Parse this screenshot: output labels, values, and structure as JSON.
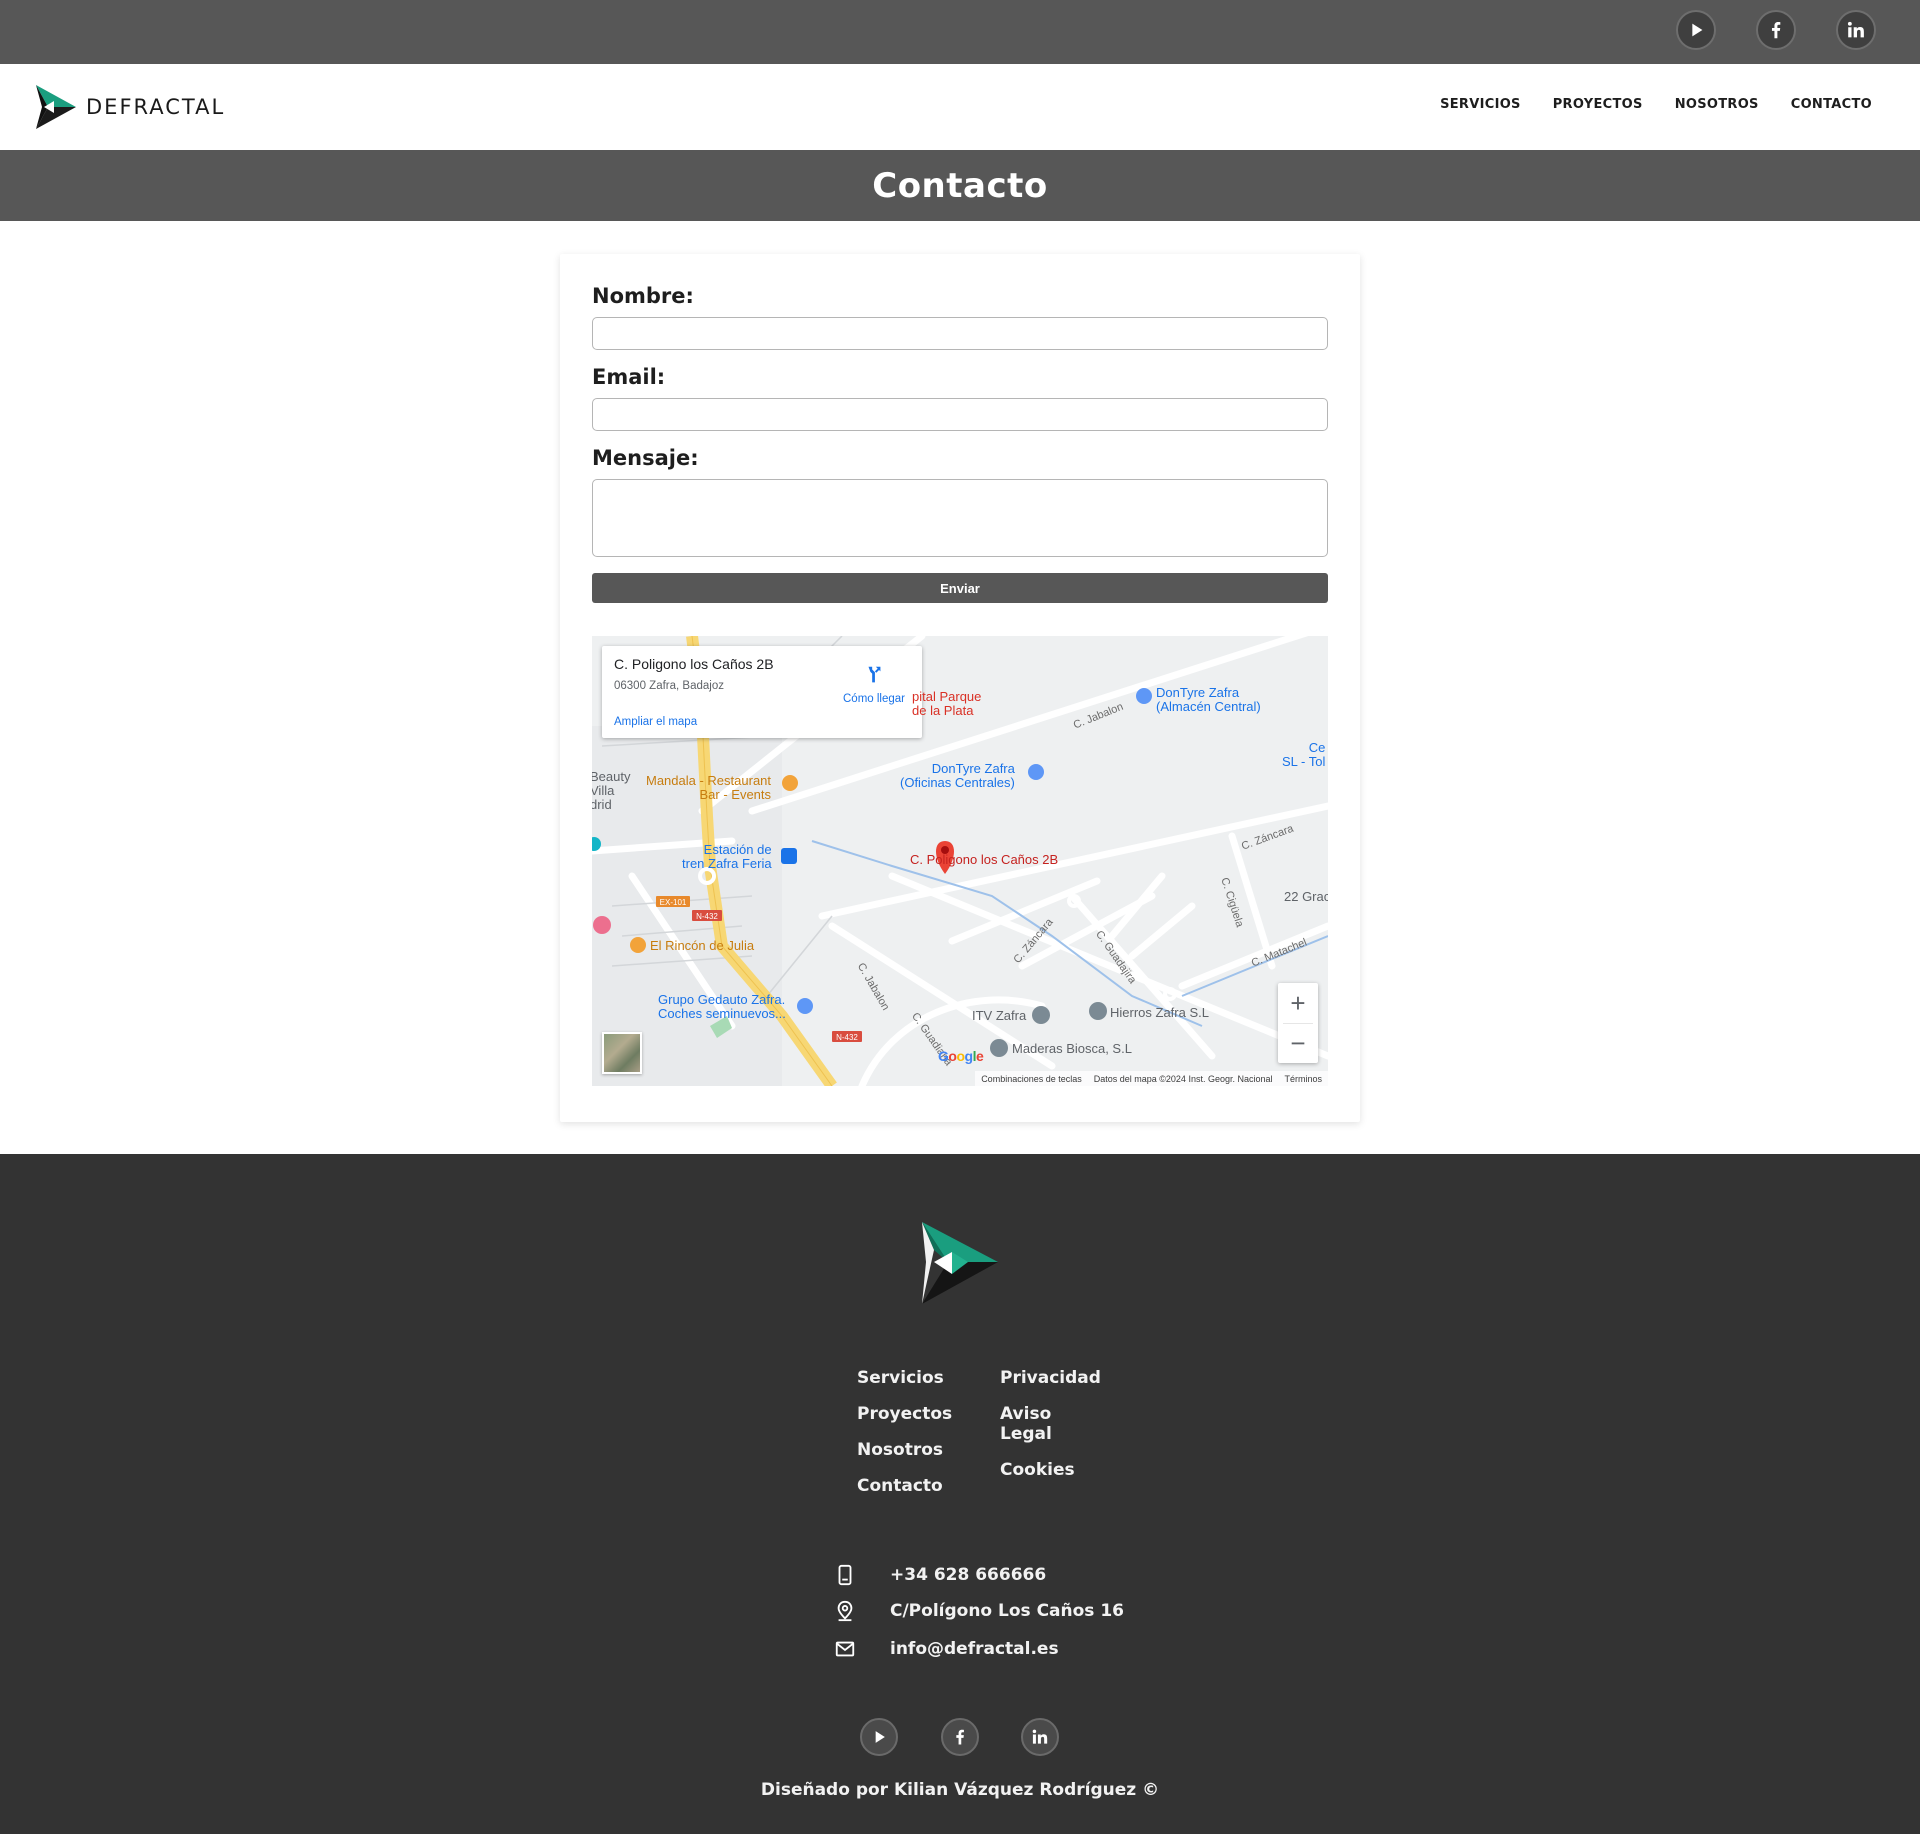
{
  "topbar": {
    "social": [
      "youtube-icon",
      "facebook-icon",
      "linkedin-icon"
    ]
  },
  "brand": {
    "name": "DEFRACTAL",
    "accent": "#1a9e7f"
  },
  "nav": {
    "items": [
      "SERVICIOS",
      "PROYECTOS",
      "NOSOTROS",
      "CONTACTO"
    ]
  },
  "page": {
    "title": "Contacto"
  },
  "form": {
    "name_label": "Nombre:",
    "name_value": "",
    "email_label": "Email:",
    "email_value": "",
    "message_label": "Mensaje:",
    "message_value": "",
    "submit_label": "Enviar"
  },
  "map": {
    "place_title": "C. Poligono los Caños 2B",
    "place_address": "06300 Zafra, Badajoz",
    "enlarge_link": "Ampliar el mapa",
    "directions_label": "Cómo llegar",
    "marker_label": "C. Poligono los Caños 2B",
    "pois": {
      "hospital": "pital Parque\nde la Plata",
      "dontyre_almacen": "DonTyre Zafra\n(Almacén Central)",
      "dontyre_oficinas": "DonTyre Zafra\n(Oficinas Centrales)",
      "mandala": "Mandala - Restaurant\nBar - Events",
      "estacion": "Estación de\ntren Zafra Feria",
      "rincon": "El Rincón de Julia",
      "gedauto": "Grupo Gedauto Zafra.\nCoches seminuevos...",
      "itv": "ITV Zafra",
      "hierros": "Hierros Zafra S.L",
      "maderas": "Maderas Biosca, S.L",
      "beauty": "Beauty\nVilla\ndrid",
      "ce": "Ce\nSL - Tol",
      "grac": "22 Grac"
    },
    "streets": {
      "jabalon_top": "C. Jabalon",
      "zancara_right": "C. Záncara",
      "cigüela": "C. Cigüela",
      "zancara_mid": "C. Záncara",
      "guadajira": "C. Guadajira",
      "matachel": "C. Matachel",
      "jabalon_bottom": "C. Jabalon",
      "guadiana": "C. Guadiana"
    },
    "road_badges": [
      "EX-101",
      "N-432",
      "N-432"
    ],
    "attribution": [
      "Combinaciones de teclas",
      "Datos del mapa ©2024 Inst. Geogr. Nacional",
      "Términos"
    ],
    "google_logo": "Google"
  },
  "footer": {
    "col1": [
      "Servicios",
      "Proyectos",
      "Nosotros",
      "Contacto"
    ],
    "col2": [
      "Privacidad",
      "Aviso\nLegal",
      "Cookies"
    ],
    "phone": "+34 628 666666",
    "address": "C/Polígono Los Caños 16",
    "email": "info@defractal.es",
    "credit": "Diseñado por Kilian Vázquez Rodríguez ©"
  }
}
